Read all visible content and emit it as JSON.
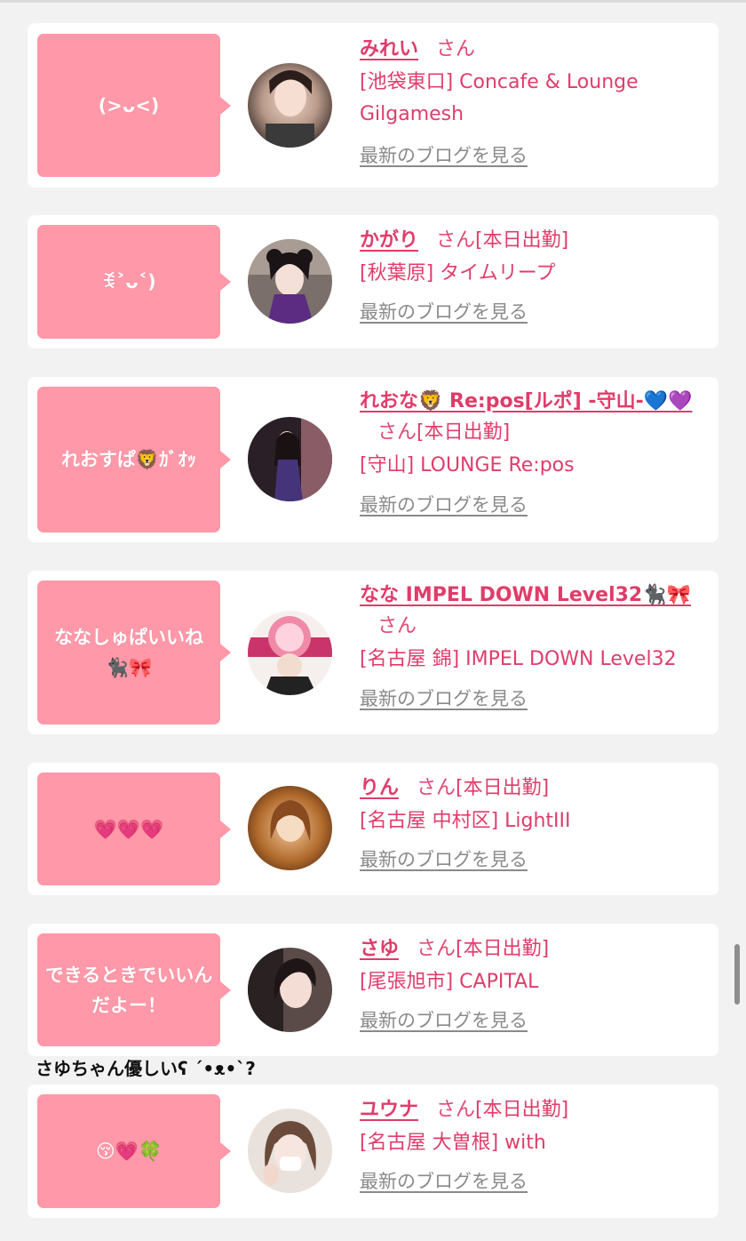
{
  "cards": [
    {
      "bubble": "(>ᴗ<)",
      "name": "みれい",
      "san": "さん",
      "status": "",
      "store": "[池袋東口] Concafe & Lounge Gilgamesh",
      "blog": "最新のブログを見る"
    },
    {
      "bubble": "ꉂ˃ᴗ˂)",
      "name": "かがり",
      "san": "さん",
      "status": "[本日出勤]",
      "store": "[秋葉原] タイムリープ",
      "blog": "最新のブログを見る"
    },
    {
      "bubble": "れおすぱ🦁ｶﾞｵｯ",
      "name": "れおな🦁 Re:pos[ルポ] -守山-💙💜",
      "san": "さん",
      "status": "[本日出勤]",
      "store": "[守山] LOUNGE Re:pos",
      "blog": "最新のブログを見る"
    },
    {
      "bubble": "ななしゅぱいいね🐈‍⬛🎀",
      "name": "なな IMPEL DOWN Level32🐈‍⬛🎀",
      "san": "さん",
      "status": "",
      "store": "[名古屋 錦] IMPEL DOWN Level32",
      "blog": "最新のブログを見る"
    },
    {
      "bubble": "💗💗💗",
      "name": "りん",
      "san": "さん",
      "status": "[本日出勤]",
      "store": "[名古屋 中村区] LightIII",
      "blog": "最新のブログを見る"
    },
    {
      "bubble": "できるときでいいんだよー！",
      "name": "さゆ",
      "san": "さん",
      "status": "[本日出勤]",
      "store": "[尾張旭市] CAPITAL",
      "blog": "最新のブログを見る"
    },
    {
      "bubble": "😚💗🍀",
      "name": "ユウナ",
      "san": "さん",
      "status": "[本日出勤]",
      "store": "[名古屋 大曽根] with",
      "blog": "最新のブログを見る"
    }
  ],
  "comment": "さゆちゃん優しいʕ ´•ᴥ•`?",
  "colors": {
    "accent": "#e03c6a",
    "bubble": "#ff98a8",
    "blog_link": "#8a8a8a",
    "background": "#f2f2f2"
  }
}
